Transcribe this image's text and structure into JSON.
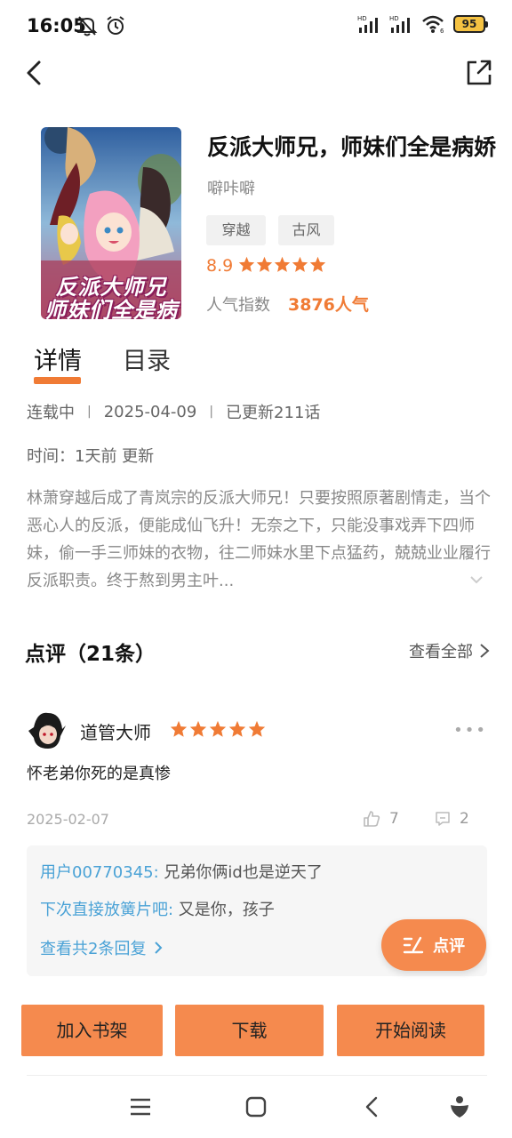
{
  "status_bar": {
    "time": "16:05",
    "battery": "95",
    "signal_label_1": "HD",
    "signal_label_2": "HD",
    "wifi_label": "6"
  },
  "book": {
    "title": "反派大师兄，师妹们全是病娇",
    "author": "噼咔噼",
    "cover_text_line1": "反派大师兄",
    "cover_text_line2": "师妹们全是病娇",
    "tags": [
      "穿越",
      "古风"
    ],
    "rating": "8.9",
    "stars": 5,
    "popularity_label": "人气指数",
    "popularity_value": "3876人气"
  },
  "tabs": {
    "details": "详情",
    "catalog": "目录"
  },
  "meta": {
    "status": "连载中",
    "date": "2025-04-09",
    "updated": "已更新211话",
    "time_line": "时间：1天前 更新"
  },
  "synopsis": "林萧穿越后成了青岚宗的反派大师兄！只要按照原著剧情走，当个恶心人的反派，便能成仙飞升！无奈之下，只能没事戏弄下四师妹，偷一手三师妹的衣物，往二师妹水里下点猛药，兢兢业业履行反派职责。终于熬到男主叶...",
  "reviews": {
    "title": "点评（21条）",
    "view_all": "查看全部",
    "items": [
      {
        "name": "道管大师",
        "stars": 5,
        "text": "怀老弟你死的是真惨",
        "date": "2025-02-07",
        "likes": "7",
        "comments": "2",
        "replies": [
          {
            "user": "用户00770345:",
            "text": " 兄弟你俩id也是逆天了"
          },
          {
            "user": "下次直接放簧片吧:",
            "text": " 又是你，孩子"
          }
        ],
        "more_replies": "查看共2条回复"
      }
    ]
  },
  "fab": {
    "label": "点评"
  },
  "actions": {
    "shelf": "加入书架",
    "download": "下载",
    "read": "开始阅读"
  },
  "colors": {
    "accent": "#f07b35",
    "button": "#f58a4e",
    "link": "#4aa2d6"
  }
}
